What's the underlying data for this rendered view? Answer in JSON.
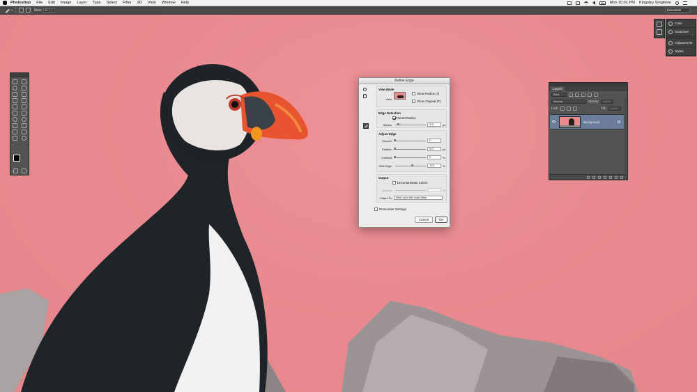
{
  "menubar": {
    "app_name": "Photoshop",
    "menus": [
      "File",
      "Edit",
      "Image",
      "Layer",
      "Type",
      "Select",
      "Filter",
      "3D",
      "View",
      "Window",
      "Help"
    ],
    "clock": "Mon 10:01 PM",
    "user": "Kingsley Singleton"
  },
  "options_bar": {
    "size_label": "Size:",
    "size_value": "10",
    "workspace": "Essentials"
  },
  "refine_edge": {
    "title": "Refine Edge",
    "view_mode": {
      "heading": "View Mode",
      "view_label": "View:",
      "show_radius": "Show Radius (J)",
      "show_original": "Show Original (P)"
    },
    "edge_detection": {
      "heading": "Edge Detection",
      "smart_radius": "Smart Radius",
      "radius_label": "Radius:",
      "radius_value": "3.5",
      "radius_unit": "px",
      "radius_level": 0.12
    },
    "adjust_edge": {
      "heading": "Adjust Edge",
      "smooth_label": "Smooth:",
      "smooth_value": "0",
      "smooth_level": 0,
      "feather_label": "Feather:",
      "feather_value": "0.0",
      "feather_unit": "px",
      "feather_level": 0,
      "contrast_label": "Contrast:",
      "contrast_value": "0",
      "contrast_unit": "%",
      "contrast_level": 0,
      "shift_label": "Shift Edge:",
      "shift_value": "+15",
      "shift_unit": "%",
      "shift_level": 0.57
    },
    "output": {
      "heading": "Output",
      "decontaminate": "Decontaminate Colors",
      "amount_label": "Amount:",
      "amount_unit": "%",
      "output_to_label": "Output To:",
      "output_to_value": "New Layer with Layer Mask"
    },
    "remember": "Remember Settings",
    "cancel": "Cancel",
    "ok": "OK"
  },
  "panels": {
    "color": "Color",
    "swatches": "Swatches",
    "adjustments": "Adjustments",
    "styles": "Styles"
  },
  "layers": {
    "tab": "Layers",
    "kind": "Kind",
    "blend_mode": "Normal",
    "opacity_label": "Opacity:",
    "opacity_value": "100%",
    "lock_label": "Lock:",
    "fill_label": "Fill:",
    "fill_value": "100%",
    "layer_name": "Background"
  }
}
